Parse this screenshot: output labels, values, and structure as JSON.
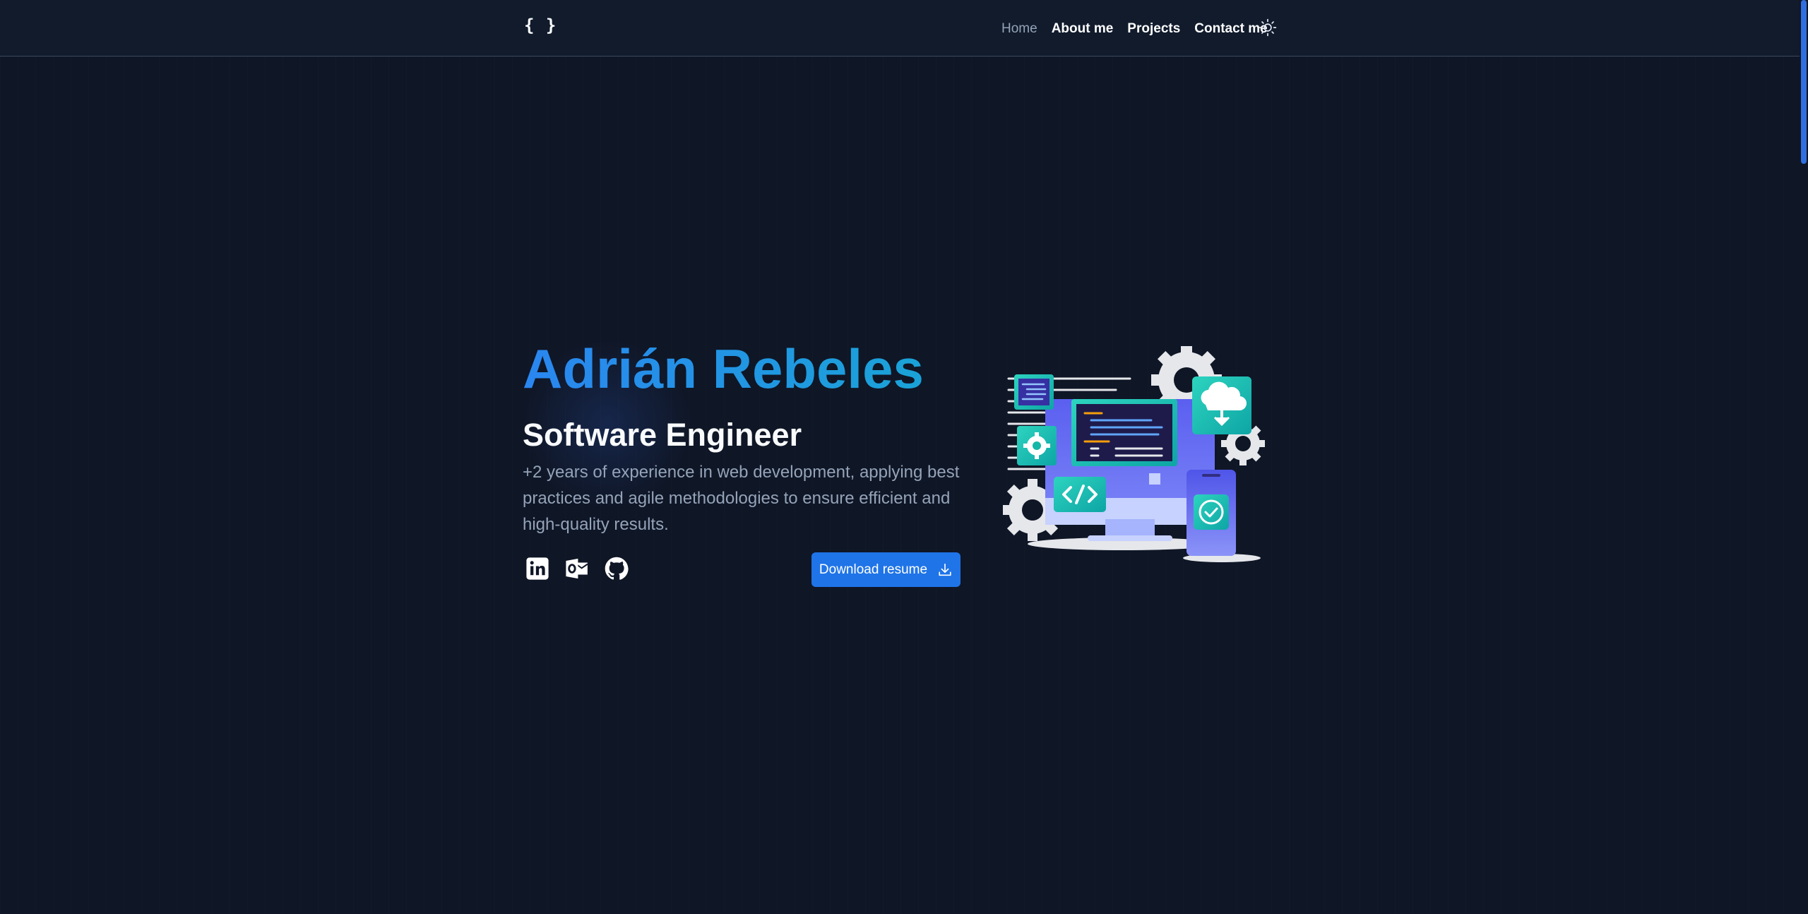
{
  "header": {
    "logo": "{ }",
    "nav": [
      {
        "label": "Home",
        "active": true
      },
      {
        "label": "About me",
        "active": false
      },
      {
        "label": "Projects",
        "active": false
      },
      {
        "label": "Contact me",
        "active": false
      }
    ],
    "theme_icon": "sun-icon"
  },
  "hero": {
    "name": "Adrián Rebeles",
    "role": "Software Engineer",
    "description": "+2 years of experience in web development, applying best practices and agile methodologies to ensure efficient and high-quality results.",
    "socials": [
      "linkedin-icon",
      "outlook-icon",
      "github-icon"
    ],
    "resume_button": "Download resume",
    "resume_icon": "download-icon"
  },
  "colors": {
    "background": "#0f1626",
    "header": "#111b2c",
    "accent": "#1f74e8",
    "name_gradient_start": "#2a86f0",
    "name_gradient_end": "#1aa3d8",
    "muted_text": "#94a3b8",
    "illustration_teal": "#2dd4bf",
    "illustration_indigo": "#5b5ff0"
  }
}
